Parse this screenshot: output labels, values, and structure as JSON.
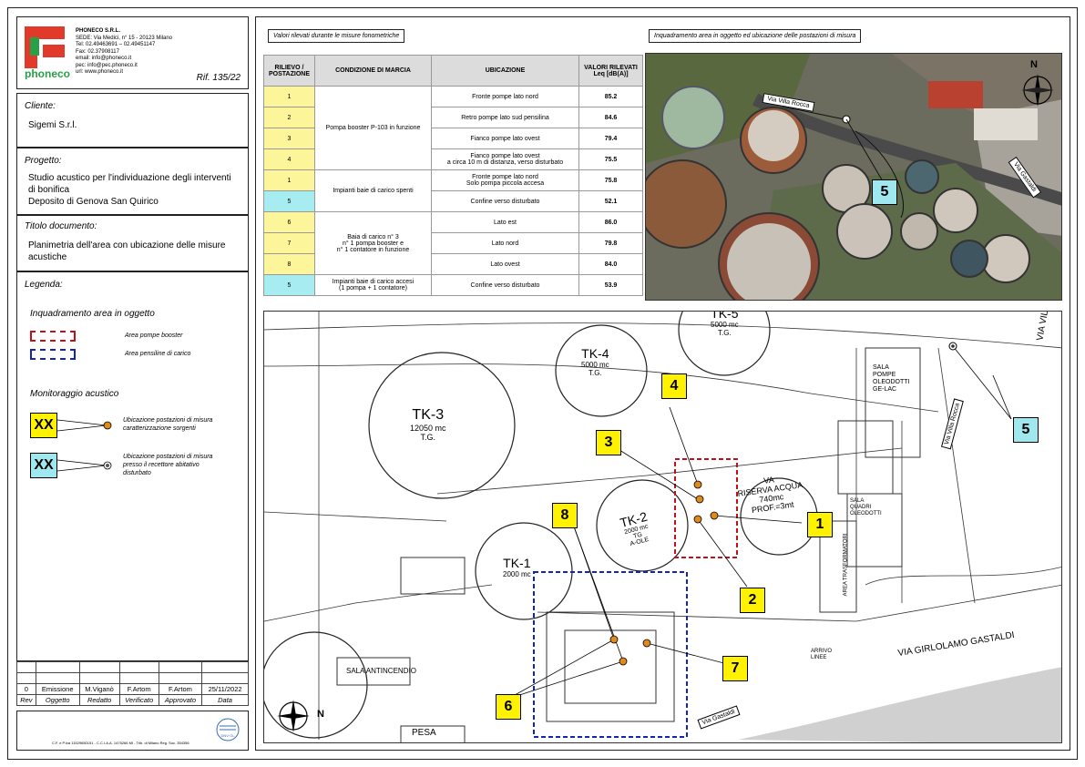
{
  "company": {
    "logo_text": "phoneco",
    "name": "PHONECO S.R.L.",
    "address_lines": [
      "SEDE: Via Medici, n° 15 - 20123 Milano",
      "Tel: 02.49463691 – 02.49451147",
      "Fax: 02.37908117",
      "email: info@phoneco.it",
      "pec: info@pec.phoneco.it",
      "url: www.phoneco.it"
    ],
    "reference": "Rif. 135/22"
  },
  "client": {
    "label": "Cliente:",
    "value": "Sigemi S.r.l."
  },
  "project": {
    "label": "Progetto:",
    "lines": [
      "Studio acustico per l'individuazione degli interventi",
      "di bonifica",
      "Deposito di Genova San Quirico"
    ]
  },
  "doc_title": {
    "label": "Titolo documento:",
    "lines": [
      "Planimetria dell'area con ubicazione delle misure",
      "acustiche"
    ]
  },
  "legend": {
    "label": "Legenda:",
    "area_heading": "Inquadramento area in oggetto",
    "red_label": "Area pompe booster",
    "blue_label": "Area pensiline di carico",
    "monitor_heading": "Monitoraggio acustico",
    "marker_text": "XX",
    "yellow_desc": [
      "Ubicazione postazioni di misura",
      "caratterizzazione sorgenti"
    ],
    "cyan_desc": [
      "Ubicazione postazioni di misura",
      "presso il recettore abitativo",
      "disturbato"
    ],
    "colors": {
      "red": "#c0121b",
      "blue": "#1324b8",
      "yellow": "#fff200",
      "cyan": "#9fe8ef",
      "dot": "#e08a1c"
    }
  },
  "revision": {
    "row": [
      "0",
      "Emissione",
      "M.Viganò",
      "F.Artom",
      "F.Artom",
      "25/11/2022"
    ],
    "headers": [
      "Rev",
      "Oggetto",
      "Redatto",
      "Verificato",
      "Approvato",
      "Data"
    ]
  },
  "footer": {
    "fiscal": "C.F. e P.Iva 11529650151 - C.C.I.A.A. 1475266 MI - Trib. di Milano Reg. Soc. 354356",
    "cert_label": "DNV·GL"
  },
  "table": {
    "caption": "Valori rilevati durante le misure fonometriche",
    "headers": [
      "RILIEVO / POSTAZIONE",
      "CONDIZIONE DI MARCIA",
      "UBICAZIONE",
      "VALORI RILEVATI Leq [dB(A)]"
    ],
    "groups": [
      {
        "condition": "Pompa booster P-103 in funzione",
        "rows": [
          {
            "pos": "1",
            "type": "yellow",
            "loc": "Fronte pompe lato nord",
            "value": "85.2"
          },
          {
            "pos": "2",
            "type": "yellow",
            "loc": "Retro pompe lato sud pensilina",
            "value": "84.6"
          },
          {
            "pos": "3",
            "type": "yellow",
            "loc": "Fianco pompe lato ovest",
            "value": "79.4"
          },
          {
            "pos": "4",
            "type": "yellow",
            "loc": "Fianco pompe lato ovest\na circa 10 m di distanza, verso disturbato",
            "value": "75.5"
          }
        ]
      },
      {
        "condition": "Impianti baie di carico spenti",
        "rows": [
          {
            "pos": "1",
            "type": "yellow",
            "loc": "Fronte pompe lato nord\nSolo pompa piccola accesa",
            "value": "75.8"
          },
          {
            "pos": "5",
            "type": "cyan",
            "loc": "Confine verso disturbato",
            "value": "52.1"
          }
        ]
      },
      {
        "condition": "Baia di carico n° 3\nn° 1 pompa booster e\nn° 1 contatore in funzione",
        "rows": [
          {
            "pos": "6",
            "type": "yellow",
            "loc": "Lato est",
            "value": "86.0"
          },
          {
            "pos": "7",
            "type": "yellow",
            "loc": "Lato nord",
            "value": "79.8"
          },
          {
            "pos": "8",
            "type": "yellow",
            "loc": "Lato ovest",
            "value": "84.0"
          }
        ]
      },
      {
        "condition": "Impianti baie di carico accesi\n(1 pompa + 1 contatore)",
        "rows": [
          {
            "pos": "5",
            "type": "cyan",
            "loc": "Confine verso disturbato",
            "value": "53.9"
          }
        ]
      }
    ]
  },
  "photo": {
    "caption": "Inquadramento area in oggetto ed ubicazione delle postazioni di misura",
    "street_1": "Via Villa Rocca",
    "street_2": "Via Gastaldi",
    "north": "N",
    "marker": "5"
  },
  "plan": {
    "tanks": [
      {
        "name": "TK-3",
        "cap": "12050 mc",
        "type": "T.G."
      },
      {
        "name": "TK-4",
        "cap": "5000 mc",
        "type": "T.G."
      },
      {
        "name": "TK-5",
        "cap": "5000 mc",
        "type": "T.G."
      },
      {
        "name": "TK-2",
        "cap": "2000 mc",
        "type": "TG",
        "extra": "A-OLE"
      },
      {
        "name": "TK-1",
        "cap": "2000 mc",
        "type": ""
      }
    ],
    "labels": {
      "riserva": [
        "VA",
        "RISERVA ACQUA",
        "740mc",
        "PROF.=3mt"
      ],
      "sala_pompe": [
        "SALA",
        "POMPE",
        "OLEODOTTI",
        "GE-LAC"
      ],
      "sala_quadri": [
        "SALA",
        "QUADRI",
        "OLEODOTTI"
      ],
      "trasformatori": "AREA TRASFORMATORI",
      "antincendio": "SALA ANTINCENDIO",
      "pesa": "PESA",
      "street_main": "VIA GIRLOLAMO GASTALDI",
      "street_villa": "Via Villa Rocca",
      "street_gastaldi": "Via Gastaldi",
      "arrivo": [
        "ARRIVO",
        "LINEE"
      ],
      "via_top": "VIA VIL"
    },
    "markers": [
      "1",
      "2",
      "3",
      "4",
      "5",
      "6",
      "7",
      "8"
    ],
    "north": "N"
  }
}
